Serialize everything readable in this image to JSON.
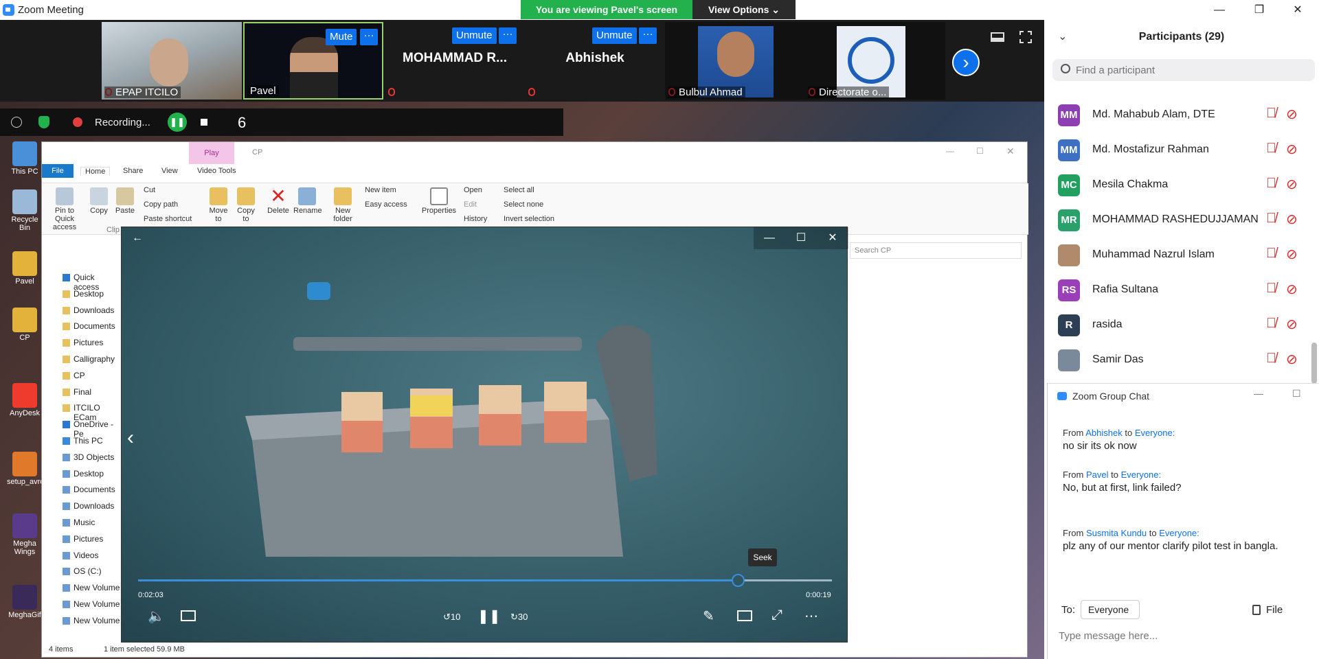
{
  "window": {
    "title": "Zoom Meeting",
    "minimize": "—",
    "restore": "❐",
    "close": "✕"
  },
  "banner": {
    "viewing": "You are viewing Pavel's screen",
    "view_options": "View Options ⌄"
  },
  "strip": {
    "tiles": [
      {
        "name": "EPAP ITCILO"
      },
      {
        "name": "Pavel",
        "button": "Mute"
      },
      {
        "name": "MOHAMMAD R...",
        "button": "Unmute"
      },
      {
        "name": "Abhishek",
        "button": "Unmute"
      },
      {
        "name": "Bulbul Ahmad"
      },
      {
        "name": "Directorate o..."
      }
    ],
    "more_dots": "···",
    "next_arrow": "›"
  },
  "participants": {
    "title": "Participants (29)",
    "search_placeholder": "Find a participant",
    "list": [
      {
        "initials": "MM",
        "name": "Md. Mahabub Alam, DTE",
        "color": "#8b3fb0"
      },
      {
        "initials": "MM",
        "name": "Md. Mostafizur Rahman",
        "color": "#3d6fc4"
      },
      {
        "initials": "MC",
        "name": "Mesila Chakma",
        "color": "#22a060"
      },
      {
        "initials": "MR",
        "name": "MOHAMMAD RASHEDUJJAMAN",
        "color": "#2aa06b"
      },
      {
        "initials": "",
        "name": "Muhammad Nazrul Islam",
        "color": "#b08a6a"
      },
      {
        "initials": "RS",
        "name": "Rafia Sultana",
        "color": "#9b3fb8"
      },
      {
        "initials": "R",
        "name": "rasida",
        "color": "#2e3f55"
      },
      {
        "initials": "",
        "name": "Samir Das",
        "color": "#7a8a9a"
      }
    ]
  },
  "chat": {
    "title": "Zoom Group Chat",
    "messages": [
      {
        "from_label": "From",
        "sender": "Abhishek",
        "to_label": "to",
        "recipient": "Everyone:",
        "text": "no sir its ok now"
      },
      {
        "from_label": "From",
        "sender": "Pavel",
        "to_label": "to",
        "recipient": "Everyone:",
        "text": "No, but at first, link failed?"
      },
      {
        "from_label": "From",
        "sender": "Susmita Kundu",
        "to_label": "to",
        "recipient": "Everyone:",
        "text": "plz any of our mentor clarify pilot test in bangla."
      }
    ],
    "to_label": "To:",
    "to_value": "Everyone ⌄",
    "file_label": "File",
    "input_placeholder": "Type message here..."
  },
  "sharebar": {
    "recording": "Recording...",
    "count": "6"
  },
  "desktop": {
    "icons": [
      "This PC",
      "Recycle Bin",
      "Pavel",
      "CP",
      "AnyDesk",
      "setup_avro",
      "Megha Wings",
      "MeghaGif"
    ]
  },
  "explorer": {
    "title": "CP",
    "context_tab": "Play",
    "tabs": [
      "File",
      "Home",
      "Share",
      "View",
      "Video Tools"
    ],
    "ribbon": {
      "pin": "Pin to Quick access",
      "copy": "Copy",
      "paste": "Paste",
      "cut": "Cut",
      "copy_path": "Copy path",
      "paste_shortcut": "Paste shortcut",
      "clipboard": "Clip",
      "move_to": "Move to",
      "copy_to": "Copy to",
      "delete": "Delete",
      "rename": "Rename",
      "new_folder": "New folder",
      "new_item": "New item",
      "easy_access": "Easy access",
      "properties": "Properties",
      "open": "Open",
      "edit": "Edit",
      "history": "History",
      "select_all": "Select all",
      "select_none": "Select none",
      "invert_selection": "Invert selection"
    },
    "search_placeholder": "Search CP",
    "nav": [
      "Quick access",
      "Desktop",
      "Downloads",
      "Documents",
      "Pictures",
      "Calligraphy",
      "CP",
      "Final",
      "ITCILO ECam",
      "OneDrive - Pe",
      "This PC",
      "3D Objects",
      "Desktop",
      "Documents",
      "Downloads",
      "Music",
      "Pictures",
      "Videos",
      "OS (C:)",
      "New Volume",
      "New Volume",
      "New Volume"
    ],
    "status": {
      "items": "4 items",
      "selected": "1 item selected  59.9 MB"
    }
  },
  "player": {
    "back": "←",
    "elapsed": "0:02:03",
    "remaining": "0:00:19",
    "progress": 0.865,
    "seek_tip": "Seek",
    "skip_back": "10",
    "skip_fwd": "30"
  }
}
